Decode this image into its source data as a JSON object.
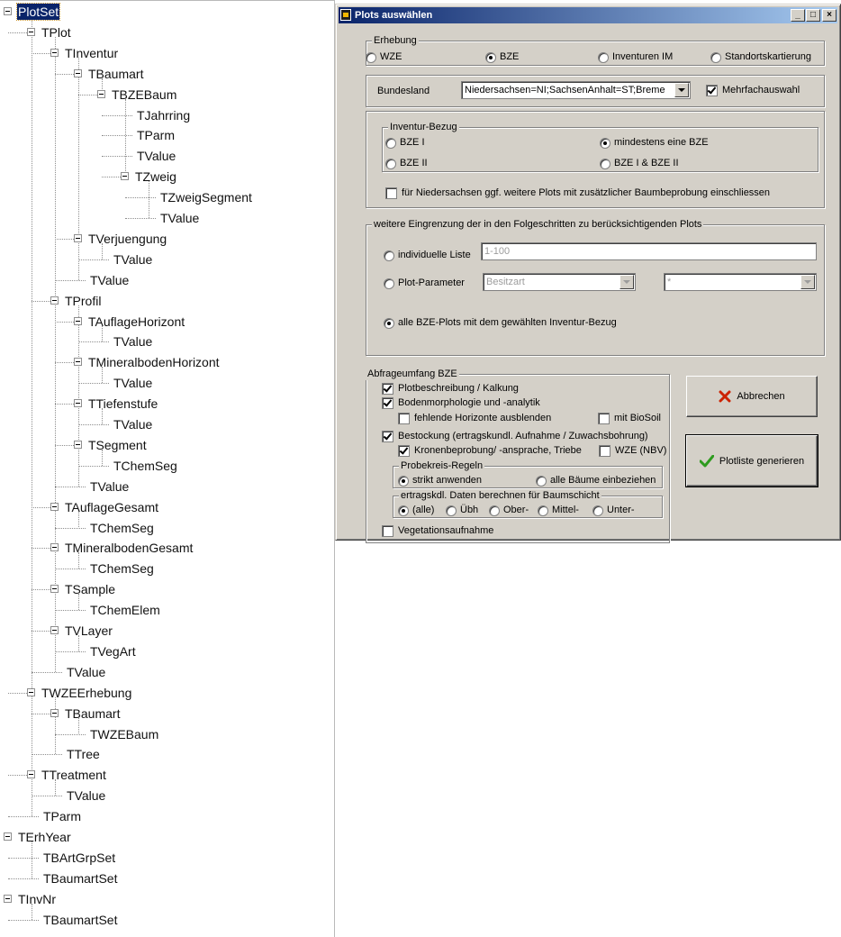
{
  "tree": {
    "nodes": [
      {
        "label": "PlotSet",
        "depth": 0,
        "expanded": true,
        "selected": true,
        "last": true
      },
      {
        "label": "TPlot",
        "depth": 1,
        "expanded": true,
        "last": false
      },
      {
        "label": "TInventur",
        "depth": 2,
        "expanded": true,
        "last": false
      },
      {
        "label": "TBaumart",
        "depth": 3,
        "expanded": true,
        "last": false
      },
      {
        "label": "TBZEBaum",
        "depth": 4,
        "expanded": true,
        "last": true
      },
      {
        "label": "TJahrring",
        "depth": 5,
        "last": false
      },
      {
        "label": "TParm",
        "depth": 5,
        "last": false
      },
      {
        "label": "TValue",
        "depth": 5,
        "last": false
      },
      {
        "label": "TZweig",
        "depth": 5,
        "expanded": true,
        "last": true
      },
      {
        "label": "TZweigSegment",
        "depth": 6,
        "last": false
      },
      {
        "label": "TValue",
        "depth": 6,
        "last": true
      },
      {
        "label": "TVerjuengung",
        "depth": 3,
        "expanded": true,
        "last": false
      },
      {
        "label": "TValue",
        "depth": 4,
        "last": true
      },
      {
        "label": "TValue",
        "depth": 3,
        "last": true
      },
      {
        "label": "TProfil",
        "depth": 2,
        "expanded": true,
        "last": false
      },
      {
        "label": "TAuflageHorizont",
        "depth": 3,
        "expanded": true,
        "last": false
      },
      {
        "label": "TValue",
        "depth": 4,
        "last": true
      },
      {
        "label": "TMineralbodenHorizont",
        "depth": 3,
        "expanded": true,
        "last": false
      },
      {
        "label": "TValue",
        "depth": 4,
        "last": true
      },
      {
        "label": "TTiefenstufe",
        "depth": 3,
        "expanded": true,
        "last": false
      },
      {
        "label": "TValue",
        "depth": 4,
        "last": true
      },
      {
        "label": "TSegment",
        "depth": 3,
        "expanded": true,
        "last": false
      },
      {
        "label": "TChemSeg",
        "depth": 4,
        "last": true
      },
      {
        "label": "TValue",
        "depth": 3,
        "last": true
      },
      {
        "label": "TAuflageGesamt",
        "depth": 2,
        "expanded": true,
        "last": false
      },
      {
        "label": "TChemSeg",
        "depth": 3,
        "last": true
      },
      {
        "label": "TMineralbodenGesamt",
        "depth": 2,
        "expanded": true,
        "last": false
      },
      {
        "label": "TChemSeg",
        "depth": 3,
        "last": true
      },
      {
        "label": "TSample",
        "depth": 2,
        "expanded": true,
        "last": false
      },
      {
        "label": "TChemElem",
        "depth": 3,
        "last": true
      },
      {
        "label": "TVLayer",
        "depth": 2,
        "expanded": true,
        "last": false
      },
      {
        "label": "TVegArt",
        "depth": 3,
        "last": true
      },
      {
        "label": "TValue",
        "depth": 2,
        "last": true
      },
      {
        "label": "TWZEErhebung",
        "depth": 1,
        "expanded": true,
        "last": false
      },
      {
        "label": "TBaumart",
        "depth": 2,
        "expanded": true,
        "last": false
      },
      {
        "label": "TWZEBaum",
        "depth": 3,
        "last": true
      },
      {
        "label": "TTree",
        "depth": 2,
        "last": true
      },
      {
        "label": "TTreatment",
        "depth": 1,
        "expanded": true,
        "last": false
      },
      {
        "label": "TValue",
        "depth": 2,
        "last": true
      },
      {
        "label": "TParm",
        "depth": 1,
        "last": true
      },
      {
        "label": "TErhYear",
        "depth": 0,
        "expanded": true,
        "last": false
      },
      {
        "label": "TBArtGrpSet",
        "depth": 1,
        "last": false
      },
      {
        "label": "TBaumartSet",
        "depth": 1,
        "last": true
      },
      {
        "label": "TInvNr",
        "depth": 0,
        "expanded": true,
        "last": true
      },
      {
        "label": "TBaumartSet",
        "depth": 1,
        "last": true
      }
    ]
  },
  "dialog": {
    "title": "Plots auswählen",
    "title_buttons": {
      "minimize": "_",
      "maximize": "□",
      "close": "×"
    },
    "erhebung": {
      "title": "Erhebung",
      "options": [
        {
          "label": "WZE",
          "checked": false
        },
        {
          "label": "BZE",
          "checked": true
        },
        {
          "label": "Inventuren IM",
          "checked": false
        },
        {
          "label": "Standortskartierung",
          "checked": false
        }
      ]
    },
    "bundesland": {
      "label": "Bundesland",
      "value": "Niedersachsen=NI;SachsenAnhalt=ST;Breme",
      "mehrfach_label": "Mehrfachauswahl",
      "mehrfach_checked": true
    },
    "inventur_bezug": {
      "title": "Inventur-Bezug",
      "options": [
        {
          "label": "BZE I",
          "checked": false
        },
        {
          "label": "mindestens eine BZE",
          "checked": true
        },
        {
          "label": "BZE II",
          "checked": false
        },
        {
          "label": "BZE I & BZE II",
          "checked": false
        }
      ],
      "extra_label": "für Niedersachsen ggf. weitere Plots mit zusätzlicher Baumbeprobung einschliessen",
      "extra_checked": false
    },
    "eingrenzung": {
      "title": "weitere Eingrenzung der in den Folgeschritten zu berücksichtigenden Plots",
      "liste_label": "individuelle Liste",
      "liste_value": "1-100",
      "param_label": "Plot-Parameter",
      "param_value": "Besitzart",
      "param_value2": "*",
      "alle_label": "alle BZE-Plots mit dem gewählten Inventur-Bezug",
      "selected": "alle"
    },
    "abfrage": {
      "title": "Abfrageumfang BZE",
      "plotbeschreibung": {
        "label": "Plotbeschreibung / Kalkung",
        "checked": true
      },
      "bodenmorph": {
        "label": "Bodenmorphologie und -analytik",
        "checked": true
      },
      "fehlende": {
        "label": "fehlende Horizonte ausblenden",
        "checked": false
      },
      "biosoil": {
        "label": "mit BioSoil",
        "checked": false
      },
      "bestockung": {
        "label": "Bestockung (ertragskundl. Aufnahme / Zuwachsbohrung)",
        "checked": true
      },
      "kronen": {
        "label": "Kronenbeprobung/ -ansprache, Triebe",
        "checked": true
      },
      "wze_nbv": {
        "label": "WZE (NBV)",
        "checked": false
      },
      "probekreis": {
        "title": "Probekreis-Regeln",
        "options": [
          {
            "label": "strikt anwenden",
            "checked": true
          },
          {
            "label": "alle Bäume einbeziehen",
            "checked": false
          }
        ]
      },
      "baumschicht": {
        "title": "ertragskdl. Daten berechnen für Baumschicht",
        "options": [
          {
            "label": "(alle)",
            "checked": true
          },
          {
            "label": "Übh",
            "checked": false
          },
          {
            "label": "Ober-",
            "checked": false
          },
          {
            "label": "Mittel-",
            "checked": false
          },
          {
            "label": "Unter-",
            "checked": false
          }
        ]
      },
      "vegetation": {
        "label": "Vegetationsaufnahme",
        "checked": false
      }
    },
    "buttons": {
      "cancel": "Abbrechen",
      "generate": "Plotliste generieren"
    },
    "colors": {
      "cancel_icon": "#cc2200",
      "ok_icon": "#2e9b1f",
      "titlebar": "#0a246a"
    }
  }
}
